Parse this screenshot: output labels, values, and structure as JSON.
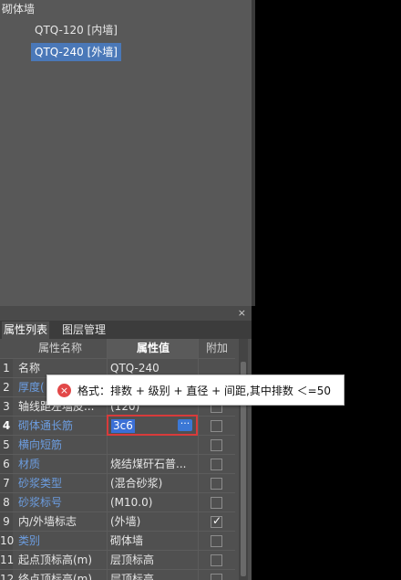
{
  "tree": {
    "root_label": "砌体墙",
    "items": [
      {
        "label": "QTQ-120 [内墙]",
        "selected": false
      },
      {
        "label": "QTQ-240 [外墙]",
        "selected": true
      }
    ]
  },
  "panel": {
    "close_icon": "×"
  },
  "tabs": [
    {
      "label": "属性列表",
      "active": true
    },
    {
      "label": "图层管理",
      "active": false
    }
  ],
  "grid": {
    "headers": {
      "name": "属性名称",
      "value": "属性值",
      "extra": "附加"
    },
    "rows": [
      {
        "num": "1",
        "name": "名称",
        "name_color": "white",
        "value": "QTQ-240",
        "checkbox": false
      },
      {
        "num": "2",
        "name": "厚度(",
        "name_color": "blue",
        "value": "",
        "checkbox": true,
        "checked": false
      },
      {
        "num": "3",
        "name": "轴线距左墙皮...",
        "name_color": "white",
        "value": "(120)",
        "checkbox": true,
        "checked": false
      },
      {
        "num": "4",
        "name": "砌体通长筋",
        "name_color": "blue",
        "value": "",
        "checkbox": true,
        "checked": false,
        "bold": true
      },
      {
        "num": "5",
        "name": "横向短筋",
        "name_color": "blue",
        "value": "",
        "checkbox": true,
        "checked": false
      },
      {
        "num": "6",
        "name": "材质",
        "name_color": "blue",
        "value": "烧结煤矸石普...",
        "checkbox": true,
        "checked": false
      },
      {
        "num": "7",
        "name": "砂浆类型",
        "name_color": "blue",
        "value": "(混合砂浆)",
        "checkbox": true,
        "checked": false
      },
      {
        "num": "8",
        "name": "砂浆标号",
        "name_color": "blue",
        "value": "(M10.0)",
        "checkbox": true,
        "checked": false
      },
      {
        "num": "9",
        "name": "内/外墙标志",
        "name_color": "white",
        "value": "(外墙)",
        "checkbox": true,
        "checked": true
      },
      {
        "num": "10",
        "name": "类别",
        "name_color": "blue",
        "value": "砌体墙",
        "checkbox": true,
        "checked": false
      },
      {
        "num": "11",
        "name": "起点顶标高(m)",
        "name_color": "white",
        "value": "层顶标高",
        "checkbox": true,
        "checked": false
      },
      {
        "num": "12",
        "name": "终点顶标高(m)",
        "name_color": "white",
        "value": "层顶标高",
        "checkbox": true,
        "checked": false
      }
    ]
  },
  "editor": {
    "value": "3c6",
    "button_label": "···"
  },
  "tooltip": {
    "icon": "×",
    "text": "格式：排数 + 级别 + 直径 + 间距,其中排数 ＜=50"
  },
  "colors": {
    "accent": "#4a78b8",
    "label_blue": "#6c9de0",
    "error_red": "#e24848"
  }
}
